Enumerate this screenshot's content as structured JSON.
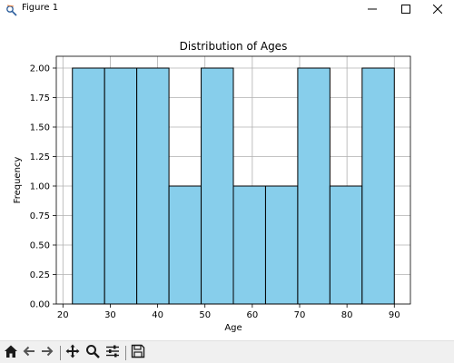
{
  "window": {
    "title": "Figure 1"
  },
  "icons": {
    "app": "matplotlib-figure-icon",
    "minimize": "minimize-icon",
    "maximize": "maximize-icon",
    "close": "close-icon",
    "home": "home-icon",
    "back": "back-arrow-icon",
    "forward": "forward-arrow-icon",
    "pan": "pan-move-icon",
    "zoom": "zoom-magnifier-icon",
    "configure": "configure-subplots-icon",
    "save": "save-floppy-icon"
  },
  "chart_data": {
    "type": "bar",
    "title": "Distribution of Ages",
    "xlabel": "Age",
    "ylabel": "Frequency",
    "bin_edges": [
      22.0,
      28.8,
      35.6,
      42.4,
      49.2,
      56.0,
      62.8,
      69.6,
      76.4,
      83.2,
      90.0
    ],
    "values": [
      2,
      2,
      2,
      1,
      2,
      1,
      1,
      2,
      1,
      2
    ],
    "xlim": [
      18.6,
      93.4
    ],
    "ylim": [
      0,
      2.1
    ],
    "xticks": [
      20,
      30,
      40,
      50,
      60,
      70,
      80,
      90
    ],
    "xtick_labels": [
      "20",
      "30",
      "40",
      "50",
      "60",
      "70",
      "80",
      "90"
    ],
    "yticks": [
      0,
      0.25,
      0.5,
      0.75,
      1.0,
      1.25,
      1.5,
      1.75,
      2.0
    ],
    "ytick_labels": [
      "0.00",
      "0.25",
      "0.50",
      "0.75",
      "1.00",
      "1.25",
      "1.50",
      "1.75",
      "2.00"
    ],
    "grid": true,
    "bar_color": "#87ceeb",
    "edge_color": "#000000"
  }
}
